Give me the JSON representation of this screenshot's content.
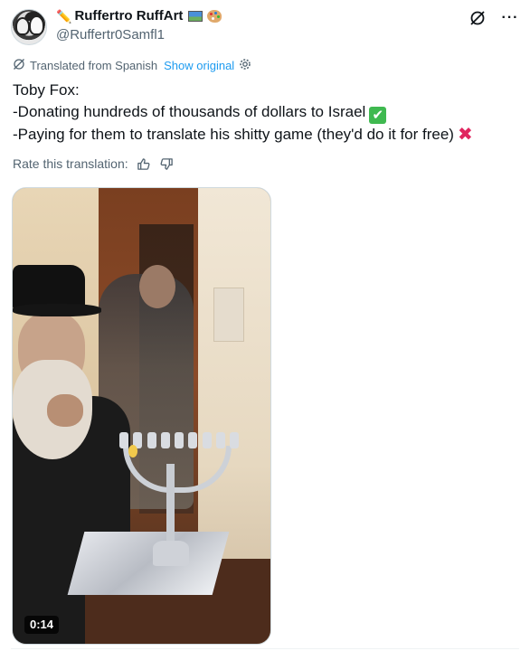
{
  "author": {
    "display_name": "Ruffertro RuffArt",
    "handle": "@Ruffertr0Samfl1",
    "avatar_icon": "avatar-image",
    "name_emojis": [
      "pencil-emoji",
      "framed-picture-emoji",
      "artist-palette-emoji"
    ]
  },
  "header_icons": {
    "grok": "grok-icon",
    "more": "more-icon",
    "more_label": "···"
  },
  "translation": {
    "label": "Translated from Spanish",
    "show_original": "Show original",
    "rate_label": "Rate this translation:"
  },
  "tweet": {
    "line1": "Toby Fox:",
    "line2": "-Donating hundreds of thousands of dollars to Israel",
    "line2_emoji": "✔",
    "line3": "-Paying for them to translate his shitty game (they'd do it for free)",
    "line3_emoji": "✖"
  },
  "video": {
    "duration": "0:14"
  },
  "colors": {
    "link": "#1d9bf0",
    "secondary_text": "#536471",
    "primary_text": "#0f1419",
    "check_green": "#3fb950",
    "cross_red": "#e0245e"
  }
}
